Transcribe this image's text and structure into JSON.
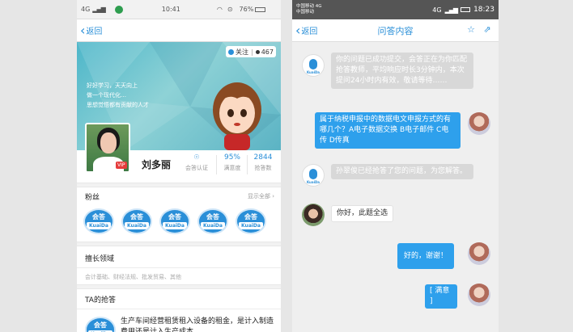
{
  "colors": {
    "accent": "#2a8fd8",
    "bubble_user": "#2ea0ec",
    "bubble_system": "#d8d8d8",
    "vip": "#e53c3c"
  },
  "left": {
    "status": {
      "net": "4G",
      "time": "10:41",
      "battery": "76%"
    },
    "back_label": "返回",
    "banner": {
      "follow_label": "关注",
      "follower_count": "467",
      "slogan": [
        "好好学习，天天向上",
        "做一个现代化…",
        "思想觉悟都有贡献的人才"
      ]
    },
    "profile": {
      "name": "刘多丽",
      "vip": "VIP",
      "stats": [
        {
          "value": "",
          "label": "会答认证"
        },
        {
          "value": "95%",
          "label": "满意度"
        },
        {
          "value": "2844",
          "label": "抢答数"
        }
      ]
    },
    "fans": {
      "title": "粉丝",
      "show_all": "显示全部 ›",
      "badge_top": "会答",
      "badge_ribbon": "KuaiDa",
      "count": 5
    },
    "specialty": {
      "title": "擅长领域",
      "tags": "会计基础、财经法规、批发贸易、其他"
    },
    "answers": {
      "title": "TA的抢答",
      "first_item": "生产车间经营租赁租入设备的租金，是计入制造费用还是计入生产成本"
    }
  },
  "right": {
    "status": {
      "carrier1": "中国移动 4G",
      "carrier2": "中国移动",
      "net": "4G",
      "time": "18:23"
    },
    "back_label": "返回",
    "title": "问答内容",
    "icons": [
      "star-icon",
      "share-icon"
    ],
    "messages": [
      {
        "from": "system",
        "text": "你的问题已成功提交，会答正在为你匹配抢答教师，平均响应时长3分钟内，本次提问24小时内有效，敬请等待……"
      },
      {
        "from": "user",
        "text": "属于纳税申报中的数据电文申报方式的有哪几个？A电子数据交换 B电子邮件 C电传 D传真"
      },
      {
        "from": "system",
        "text": "孙翠俊已经抢答了您的问题，为您解答。"
      },
      {
        "from": "teacher",
        "text": "你好，此题全选"
      },
      {
        "from": "user",
        "text": "好的，谢谢！"
      },
      {
        "from": "user",
        "text": "[ 满意 ]"
      }
    ]
  }
}
